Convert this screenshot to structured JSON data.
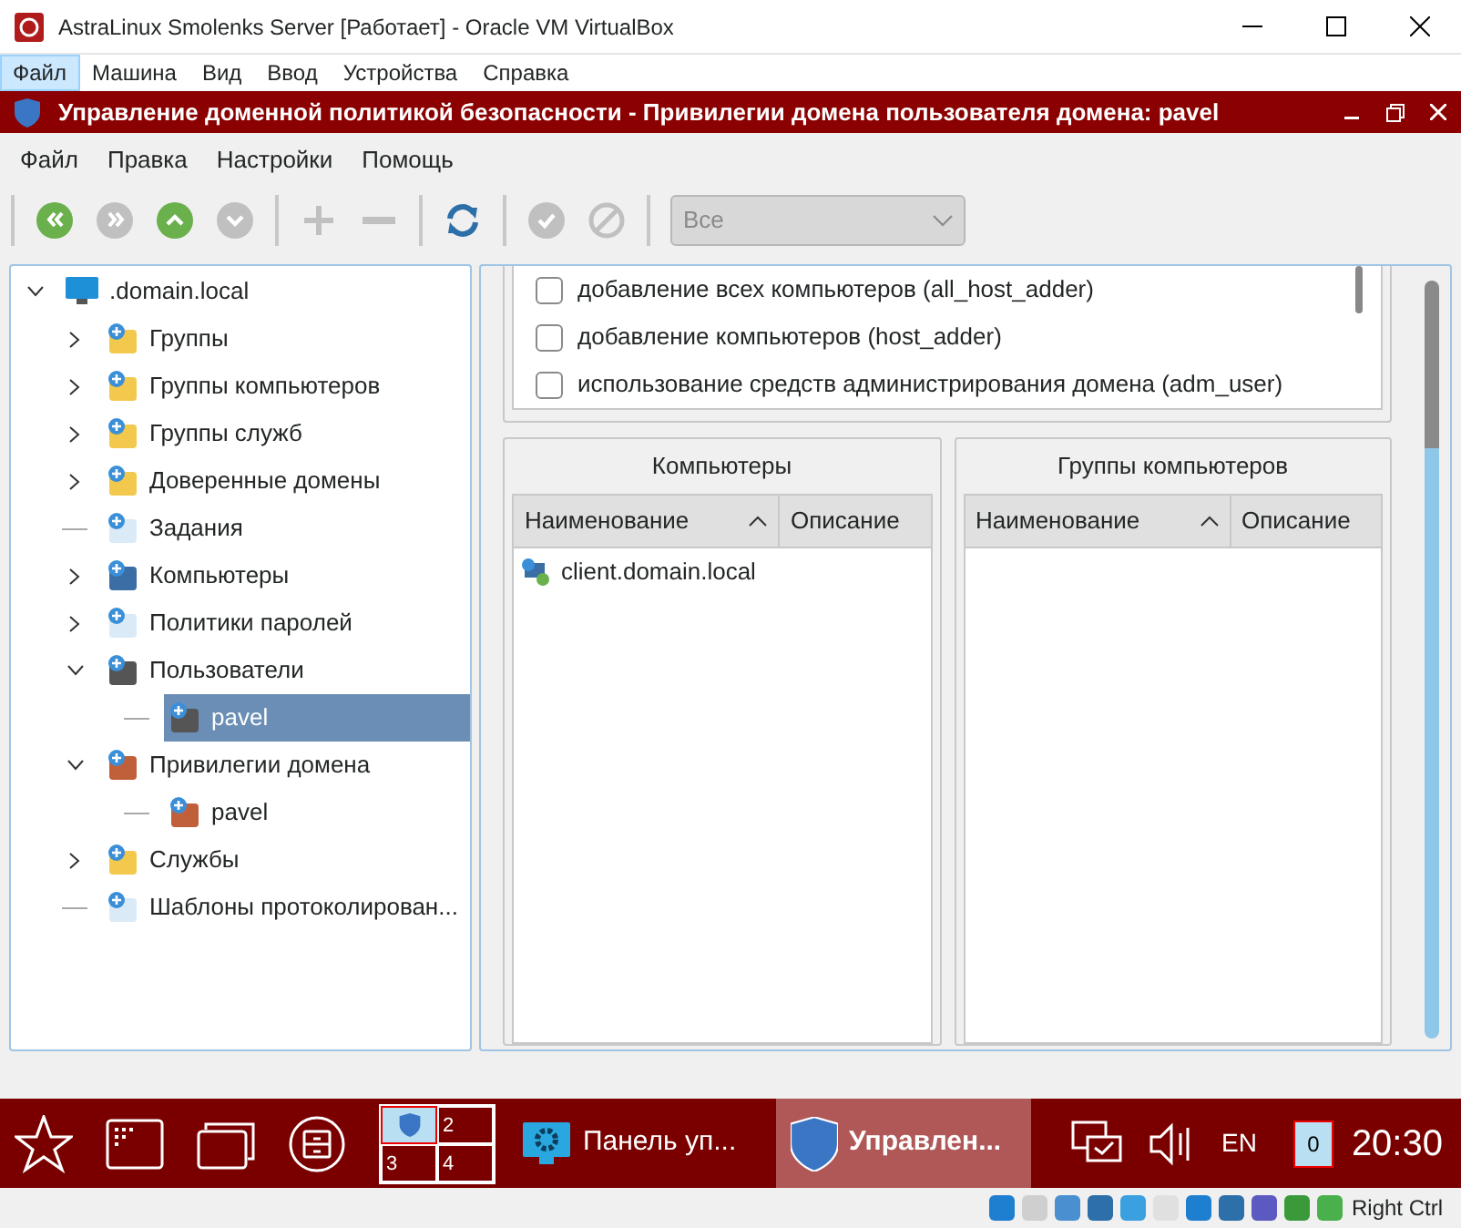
{
  "host_window": {
    "title": "AstraLinux Smolenks Server [Работает] - Oracle VM VirtualBox",
    "menu": [
      {
        "label": "Файл",
        "selected": true
      },
      {
        "label": "Машина",
        "selected": false
      },
      {
        "label": "Вид",
        "selected": false
      },
      {
        "label": "Ввод",
        "selected": false
      },
      {
        "label": "Устройства",
        "selected": false
      },
      {
        "label": "Справка",
        "selected": false
      }
    ]
  },
  "app_window": {
    "title": "Управление доменной политикой безопасности - Привилегии домена пользователя домена: pavel",
    "menu": [
      "Файл",
      "Правка",
      "Настройки",
      "Помощь"
    ],
    "toolbar": [
      {
        "kind": "first",
        "enabled": true
      },
      {
        "kind": "last",
        "enabled": false
      },
      {
        "kind": "up",
        "enabled": true
      },
      {
        "kind": "down",
        "enabled": false
      },
      {
        "kind": "sep"
      },
      {
        "kind": "add",
        "enabled": false
      },
      {
        "kind": "remove",
        "enabled": false
      },
      {
        "kind": "sep"
      },
      {
        "kind": "refresh",
        "enabled": true
      },
      {
        "kind": "sep"
      },
      {
        "kind": "apply",
        "enabled": false
      },
      {
        "kind": "cancel",
        "enabled": false
      },
      {
        "kind": "sep"
      }
    ],
    "filter": {
      "value": "Все",
      "disabled": true
    }
  },
  "tree": [
    {
      "label": ".domain.local",
      "kind": "domain",
      "expanded": true,
      "selected": false,
      "children": [
        {
          "label": "Группы",
          "kind": "groups",
          "expanded": false,
          "selected": false
        },
        {
          "label": "Группы компьютеров",
          "kind": "computer-groups",
          "expanded": false,
          "selected": false
        },
        {
          "label": "Группы служб",
          "kind": "service-groups",
          "expanded": false,
          "selected": false
        },
        {
          "label": "Доверенные домены",
          "kind": "trusted",
          "expanded": false,
          "selected": false
        },
        {
          "label": "Задания",
          "kind": "tasks",
          "selected": false
        },
        {
          "label": "Компьютеры",
          "kind": "computers",
          "expanded": false,
          "selected": false
        },
        {
          "label": "Политики паролей",
          "kind": "password",
          "expanded": false,
          "selected": false
        },
        {
          "label": "Пользователи",
          "kind": "users",
          "expanded": true,
          "selected": false,
          "children": [
            {
              "label": "pavel",
              "kind": "user",
              "selected": true
            }
          ]
        },
        {
          "label": "Привилегии домена",
          "kind": "privileges",
          "expanded": true,
          "selected": false,
          "children": [
            {
              "label": "pavel",
              "kind": "privilege",
              "selected": false
            }
          ]
        },
        {
          "label": "Службы",
          "kind": "services",
          "expanded": false,
          "selected": false
        },
        {
          "label": "Шаблоны протоколирован...",
          "kind": "templates",
          "selected": false
        }
      ]
    }
  ],
  "privileges": [
    {
      "label": "добавление всех компьютеров (all_host_adder)",
      "checked": false
    },
    {
      "label": "добавление компьютеров (host_adder)",
      "checked": false
    },
    {
      "label": "использование средств администрирования домена (adm_user)",
      "checked": false
    }
  ],
  "panels": [
    {
      "title": "Компьютеры",
      "columns": [
        "Наименование",
        "Описание"
      ],
      "rows": [
        {
          "name": "client.domain.local"
        }
      ]
    },
    {
      "title": "Группы компьютеров",
      "columns": [
        "Наименование",
        "Описание"
      ]
    }
  ],
  "taskbar": {
    "pager": [
      "2",
      "3",
      "4"
    ],
    "tasks": [
      {
        "label": "Панель уп...",
        "kind": "control-panel",
        "selected": false
      },
      {
        "label": "Управлен...",
        "kind": "ald",
        "selected": true
      }
    ],
    "language": "EN",
    "notifications": "0",
    "clock": "20:30"
  },
  "vbox_status": {
    "host_key": "Right Ctrl"
  }
}
